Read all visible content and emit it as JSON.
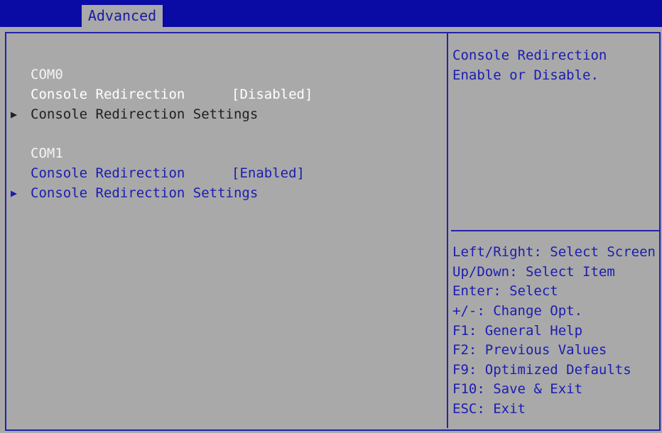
{
  "tabs": {
    "active": "Advanced"
  },
  "menu": {
    "com0": {
      "heading": "COM0",
      "redirection_label": "Console Redirection",
      "redirection_value": "[Disabled]",
      "settings_label": "Console Redirection Settings"
    },
    "com1": {
      "heading": "COM1",
      "redirection_label": "Console Redirection",
      "redirection_value": "[Enabled]",
      "settings_label": "Console Redirection Settings"
    },
    "submenu_arrow": "▶"
  },
  "help": {
    "description_line1": "Console Redirection",
    "description_line2": "Enable or Disable."
  },
  "keys": [
    "Left/Right: Select Screen",
    "Up/Down: Select Item",
    "Enter: Select",
    "+/-: Change Opt.",
    "F1: General Help",
    "F2: Previous Values",
    "F9: Optimized Defaults",
    "F10: Save & Exit",
    "ESC: Exit"
  ],
  "colors": {
    "background": "#a9a9a9",
    "frame_blue": "#2222aa",
    "header_blue": "#0a0aa5",
    "text_blue": "#1c1cb0",
    "selected_white": "#ffffff"
  }
}
